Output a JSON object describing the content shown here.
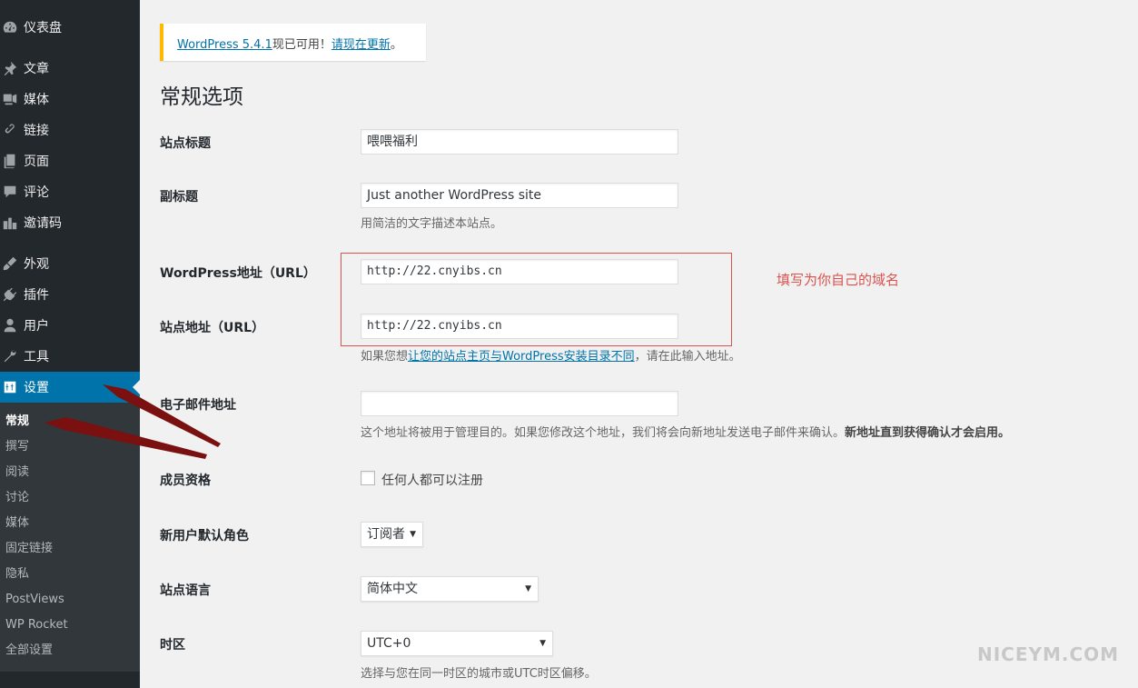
{
  "sidebar": {
    "items": [
      {
        "icon": "dashboard-icon",
        "label": "仪表盘"
      },
      {
        "icon": "pushpin-icon",
        "label": "文章"
      },
      {
        "icon": "media-icon",
        "label": "媒体"
      },
      {
        "icon": "link-icon",
        "label": "链接"
      },
      {
        "icon": "page-icon",
        "label": "页面"
      },
      {
        "icon": "comment-icon",
        "label": "评论"
      },
      {
        "icon": "invite-code-icon",
        "label": "邀请码"
      },
      {
        "icon": "appearance-icon",
        "label": "外观"
      },
      {
        "icon": "plugin-icon",
        "label": "插件"
      },
      {
        "icon": "user-icon",
        "label": "用户"
      },
      {
        "icon": "wrench-icon",
        "label": "工具"
      },
      {
        "icon": "settings-icon",
        "label": "设置"
      }
    ],
    "submenu": [
      "常规",
      "撰写",
      "阅读",
      "讨论",
      "媒体",
      "固定链接",
      "隐私",
      "PostViews",
      "WP Rocket",
      "全部设置"
    ]
  },
  "notice": {
    "version_link": "WordPress 5.4.1",
    "middle_text": "现已可用！",
    "update_link": "请现在更新",
    "end_text": "。"
  },
  "page_title": "常规选项",
  "form": {
    "site_title": {
      "label": "站点标题",
      "value": "喂喂福利"
    },
    "tagline": {
      "label": "副标题",
      "value": "Just another WordPress site",
      "desc": "用简洁的文字描述本站点。"
    },
    "wp_url": {
      "label": "WordPress地址（URL）",
      "value": "http://22.cnyibs.cn"
    },
    "site_url": {
      "label": "站点地址（URL）",
      "value": "http://22.cnyibs.cn",
      "desc_before": "如果您想",
      "desc_link": "让您的站点主页与WordPress安装目录不同",
      "desc_after": "，请在此输入地址。"
    },
    "email": {
      "label": "电子邮件地址",
      "value": "",
      "desc": "这个地址将被用于管理目的。如果您修改这个地址，我们将会向新地址发送电子邮件来确认。",
      "desc_bold": "新地址直到获得确认才会启用。"
    },
    "membership": {
      "label": "成员资格",
      "checkbox_label": "任何人都可以注册",
      "checked": false
    },
    "default_role": {
      "label": "新用户默认角色",
      "value": "订阅者"
    },
    "language": {
      "label": "站点语言",
      "value": "简体中文"
    },
    "timezone": {
      "label": "时区",
      "value": "UTC+0",
      "desc": "选择与您在同一时区的城市或UTC时区偏移。"
    }
  },
  "annotation": "填写为你自己的域名",
  "watermark": "NICEYM.COM",
  "colors": {
    "sidebar": "#23282d",
    "active": "#0073aa",
    "annotation": "#d9534f",
    "arrow": "#7a1010"
  }
}
